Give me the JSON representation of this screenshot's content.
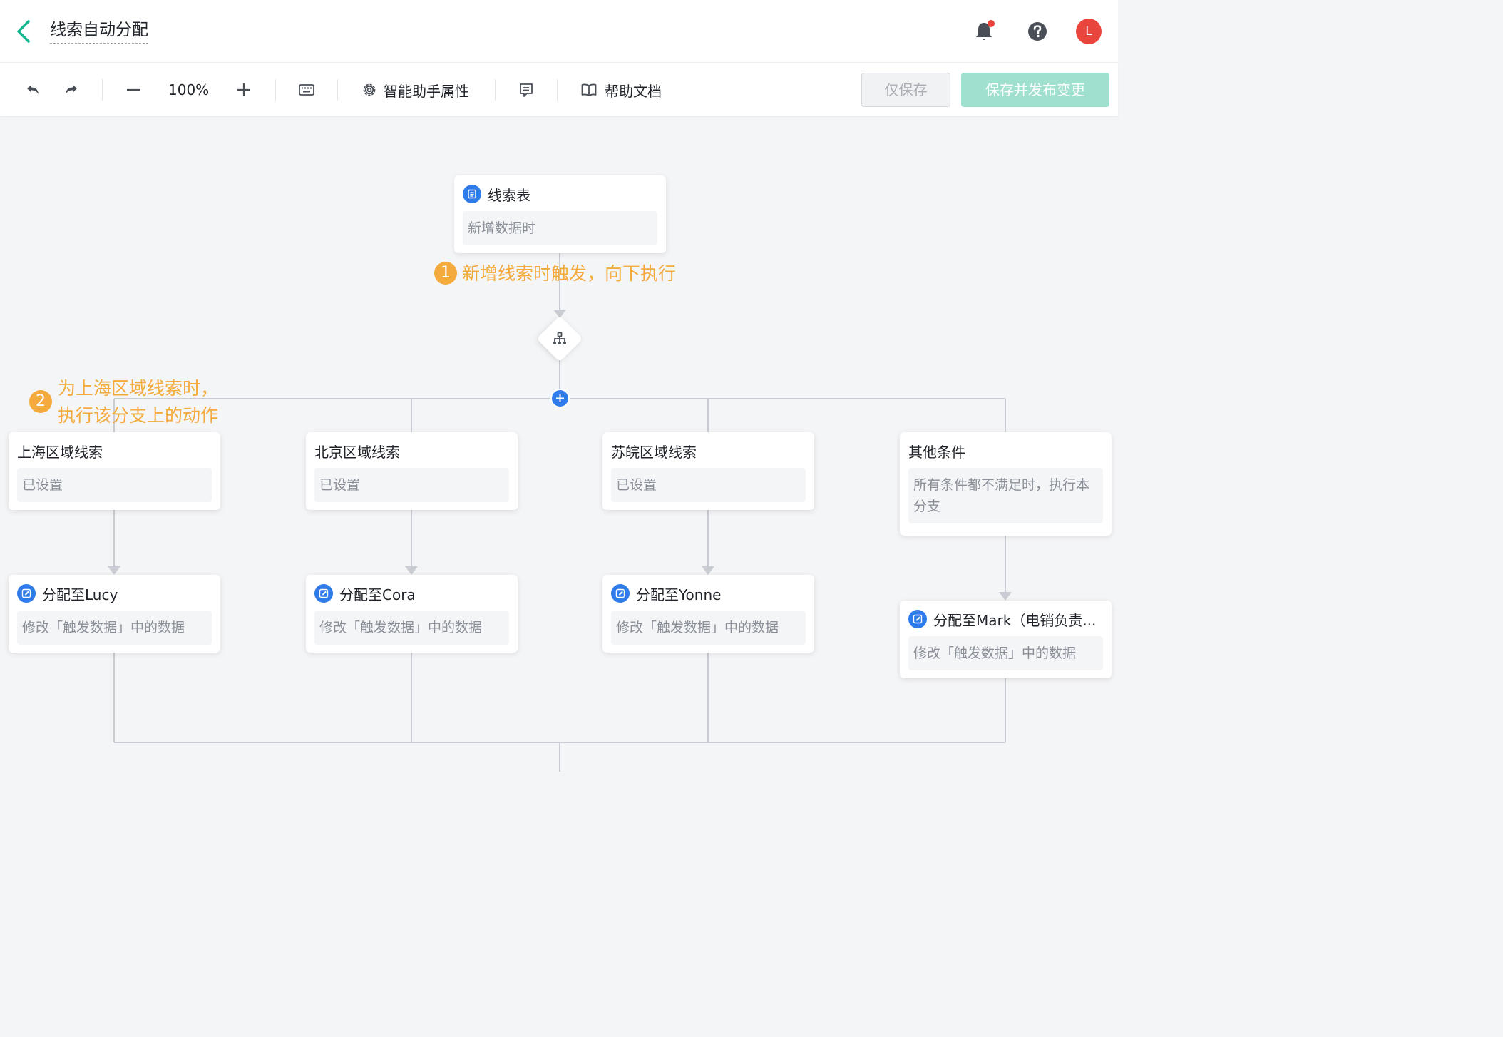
{
  "header": {
    "title": "线索自动分配",
    "avatar_letter": "L",
    "icons": [
      "chevron-left-icon",
      "bell-icon",
      "help-icon"
    ]
  },
  "toolbar": {
    "zoom": "100%",
    "assistant_label": "智能助手属性",
    "help_doc_label": "帮助文档",
    "save_label": "仅保存",
    "publish_label": "保存并发布变更"
  },
  "colors": {
    "accent_green": "#14b58f",
    "primary_blue": "#2f7bea",
    "annotation_orange": "#f4aa3c",
    "publish_button": "#9fe0cf",
    "notification_dot": "#e8453c"
  },
  "trigger": {
    "title": "线索表",
    "desc": "新增数据时"
  },
  "annotations": {
    "one_num": "1",
    "one_text": "新增线索时触发，向下执行",
    "two_num": "2",
    "two_line1": "为上海区域线索时，",
    "two_line2": "执行该分支上的动作"
  },
  "branches": [
    {
      "condition": "上海区域线索",
      "condition_desc": "已设置",
      "action": "分配至Lucy",
      "action_desc": "修改「触发数据」中的数据"
    },
    {
      "condition": "北京区域线索",
      "condition_desc": "已设置",
      "action": "分配至Cora",
      "action_desc": "修改「触发数据」中的数据"
    },
    {
      "condition": "苏皖区域线索",
      "condition_desc": "已设置",
      "action": "分配至Yonne",
      "action_desc": "修改「触发数据」中的数据"
    },
    {
      "condition": "其他条件",
      "condition_desc": "所有条件都不满足时，执行本分支",
      "action": "分配至Mark（电销负责...",
      "action_desc": "修改「触发数据」中的数据"
    }
  ]
}
